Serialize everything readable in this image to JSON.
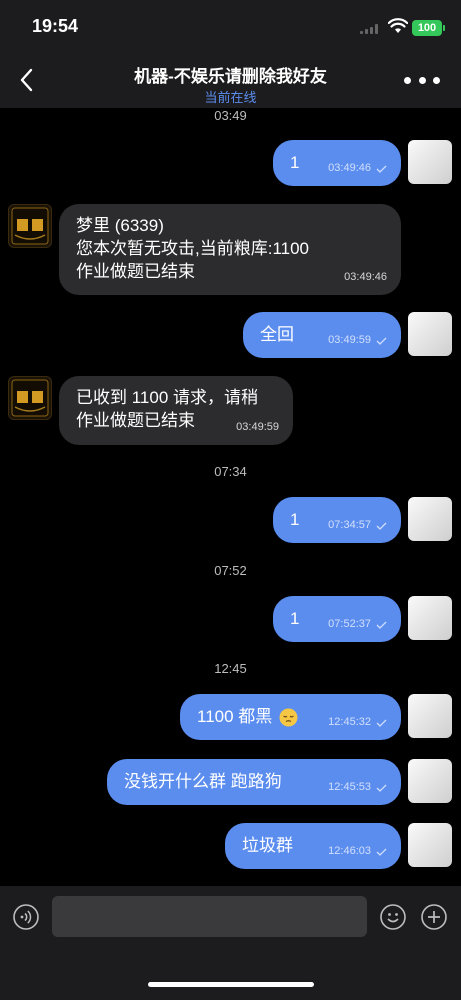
{
  "status_bar": {
    "time": "19:54",
    "battery": "100"
  },
  "header": {
    "title": "机器-不娱乐请删除我好友",
    "subtitle": "当前在线"
  },
  "messages": [
    {
      "type": "timestamp",
      "text": "03:49"
    },
    {
      "type": "out",
      "text": "1",
      "time": "03:49:46",
      "read": true
    },
    {
      "type": "in",
      "text": "梦里 (6339)\n您本次暂无攻击,当前粮库:1100\n作业做题已结束",
      "time": "03:49:46"
    },
    {
      "type": "out",
      "text": "全回",
      "time": "03:49:59",
      "read": true
    },
    {
      "type": "in",
      "text": "已收到 1100 请求，请稍\n作业做题已结束",
      "time": "03:49:59"
    },
    {
      "type": "timestamp",
      "text": "07:34"
    },
    {
      "type": "out",
      "text": "1",
      "time": "07:34:57",
      "read": true
    },
    {
      "type": "timestamp",
      "text": "07:52"
    },
    {
      "type": "out",
      "text": "1",
      "time": "07:52:37",
      "read": true
    },
    {
      "type": "timestamp",
      "text": "12:45"
    },
    {
      "type": "out",
      "text": "1100 都黑",
      "emoji": "pensive-face",
      "time": "12:45:32",
      "read": true
    },
    {
      "type": "out",
      "text": "没钱开什么群 跑路狗",
      "time": "12:45:53",
      "read": true
    },
    {
      "type": "out",
      "text": "垃圾群",
      "time": "12:46:03",
      "read": true
    }
  ],
  "composer": {
    "placeholder": "",
    "value": ""
  },
  "icons": {
    "back": "chevron-left-icon",
    "more": "more-dots-icon",
    "voice": "voice-icon",
    "emoji": "emoji-icon",
    "add": "add-icon",
    "read": "read-check-icon"
  },
  "colors": {
    "outgoing_bubble": "#5b8def",
    "incoming_bubble": "#2c2c2e",
    "online_text": "#5b8def",
    "battery": "#34c759"
  }
}
